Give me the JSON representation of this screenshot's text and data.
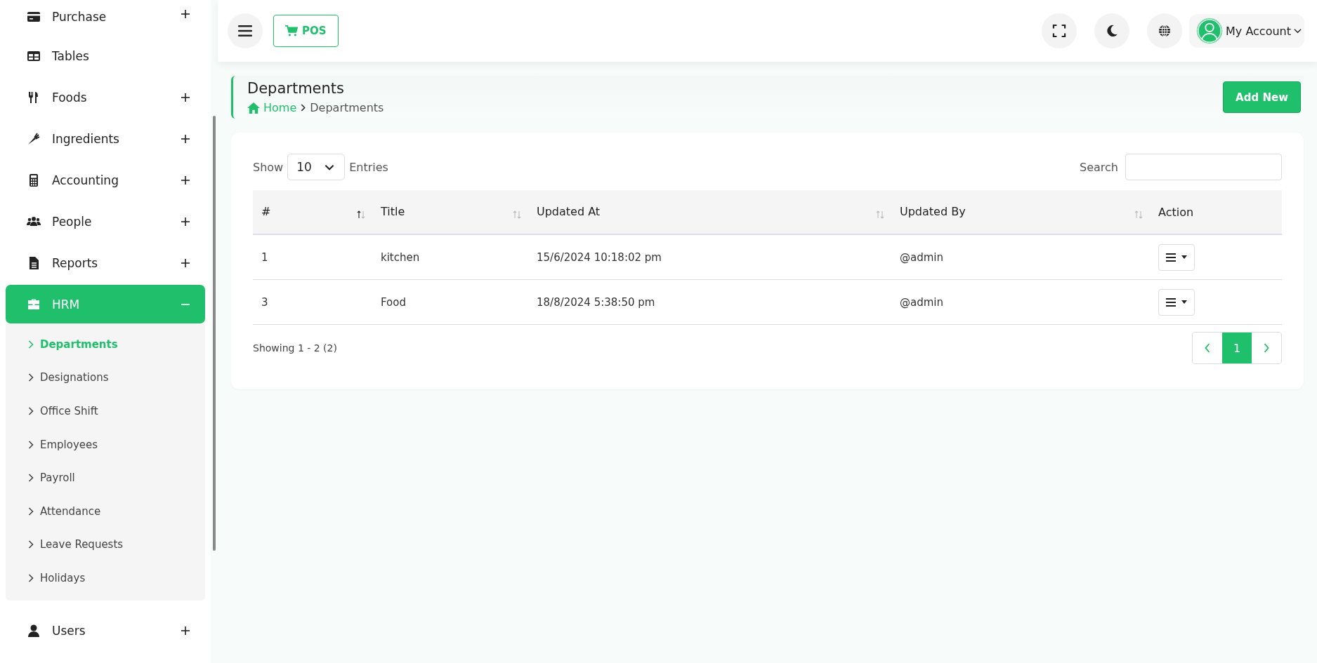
{
  "sidebar": {
    "items": [
      {
        "label": "Purchase",
        "expanded": false
      },
      {
        "label": "Tables"
      },
      {
        "label": "Foods",
        "expanded": false
      },
      {
        "label": "Ingredients",
        "expanded": false
      },
      {
        "label": "Accounting",
        "expanded": false
      },
      {
        "label": "People",
        "expanded": false
      },
      {
        "label": "Reports",
        "expanded": false
      },
      {
        "label": "HRM",
        "expanded": true,
        "children": [
          {
            "label": "Departments",
            "selected": true
          },
          {
            "label": "Designations",
            "selected": false
          },
          {
            "label": "Office Shift",
            "selected": false
          },
          {
            "label": "Employees",
            "selected": false
          },
          {
            "label": "Payroll",
            "selected": false
          },
          {
            "label": "Attendance",
            "selected": false
          },
          {
            "label": "Leave Requests",
            "selected": false
          },
          {
            "label": "Holidays",
            "selected": false
          }
        ]
      },
      {
        "label": "Users",
        "expanded": false
      }
    ]
  },
  "topbar": {
    "pos_button": "POS",
    "account": "My Account"
  },
  "page_header": {
    "title": "Departments",
    "breadcrumb": [
      "Home",
      "Departments"
    ],
    "add_button": "Add New"
  },
  "table": {
    "show_label": "Show",
    "page_size": "10",
    "entries_label": "Entries",
    "search_label": "Search",
    "columns": [
      {
        "label": "#",
        "sorted": true
      },
      {
        "label": "Title",
        "sorted": false
      },
      {
        "label": "Updated At",
        "sorted": false
      },
      {
        "label": "Updated By",
        "sorted": false
      },
      {
        "label": "Action"
      }
    ],
    "rows": [
      {
        "cells": [
          "1",
          "kitchen",
          "15/6/2024 10:18:02 pm",
          "@admin"
        ]
      },
      {
        "cells": [
          "3",
          "Food",
          "18/8/2024 5:38:50 pm",
          "@admin"
        ]
      }
    ],
    "summary": "Showing 1 - 2 (2)",
    "pages": [
      {
        "label": "1",
        "selected": true
      }
    ]
  }
}
